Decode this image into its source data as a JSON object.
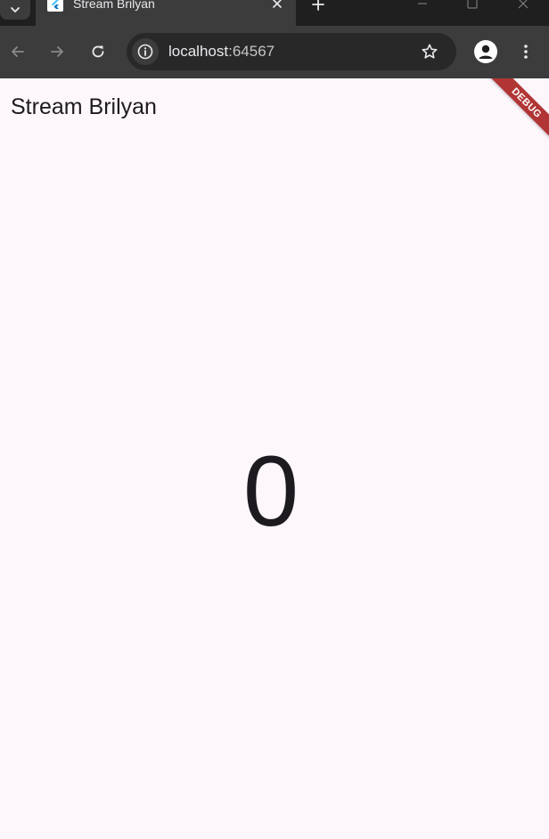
{
  "browser": {
    "tab": {
      "title": "Stream Brilyan"
    },
    "address_bar": {
      "host": "localhost",
      "port": ":64567"
    },
    "colors": {
      "chrome_dark": "#1f1f1f",
      "chrome_toolbar": "#3c3c3c",
      "omnibox": "#282828"
    }
  },
  "app": {
    "title": "Stream Brilyan",
    "counter_value": "0",
    "debug_banner": "DEBUG",
    "colors": {
      "background": "#fdf7fc",
      "text": "#1d1b20",
      "debug_banner": "#b13535"
    }
  },
  "icons": {
    "tab_search": "chevron-down-icon",
    "favicon": "flutter-icon",
    "tab_close": "close-icon",
    "new_tab": "plus-icon",
    "minimize": "minimize-icon",
    "maximize": "maximize-icon",
    "window_close": "close-icon",
    "back": "arrow-left-icon",
    "forward": "arrow-right-icon",
    "reload": "reload-icon",
    "site_info": "info-icon",
    "bookmark": "star-icon",
    "profile": "person-icon",
    "menu": "more-vertical-icon"
  }
}
